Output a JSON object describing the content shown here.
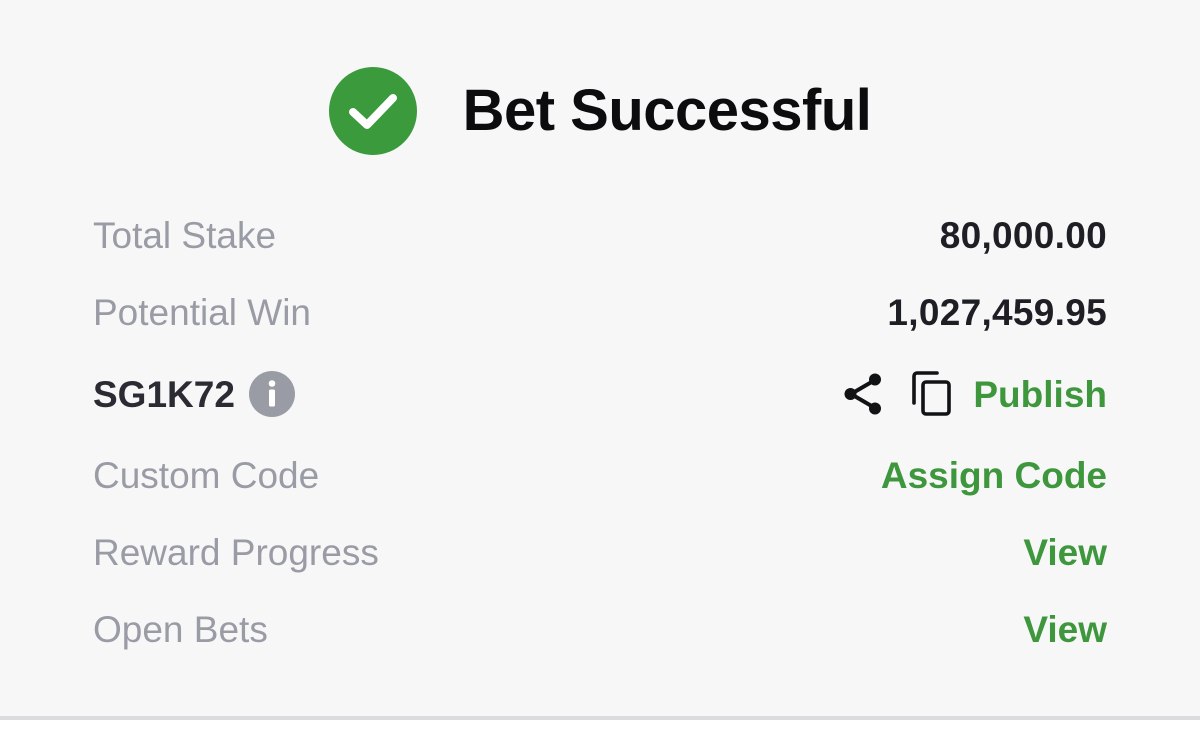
{
  "header": {
    "title": "Bet Successful",
    "icon": "check-circle-icon",
    "icon_color": "#3a9a3c"
  },
  "rows": {
    "total_stake": {
      "label": "Total Stake",
      "value": "80,000.00"
    },
    "potential_win": {
      "label": "Potential Win",
      "value": "1,027,459.95"
    },
    "booking": {
      "code": "SG1K72",
      "info_icon": "info-icon",
      "share_icon": "share-icon",
      "copy_icon": "copy-icon",
      "publish_label": "Publish"
    },
    "custom_code": {
      "label": "Custom Code",
      "action": "Assign Code"
    },
    "reward_progress": {
      "label": "Reward Progress",
      "action": "View"
    },
    "open_bets": {
      "label": "Open Bets",
      "action": "View"
    }
  },
  "colors": {
    "accent": "#3f973d",
    "label": "#9a9ca5",
    "value": "#1e1f24",
    "background": "#f7f7f8"
  }
}
